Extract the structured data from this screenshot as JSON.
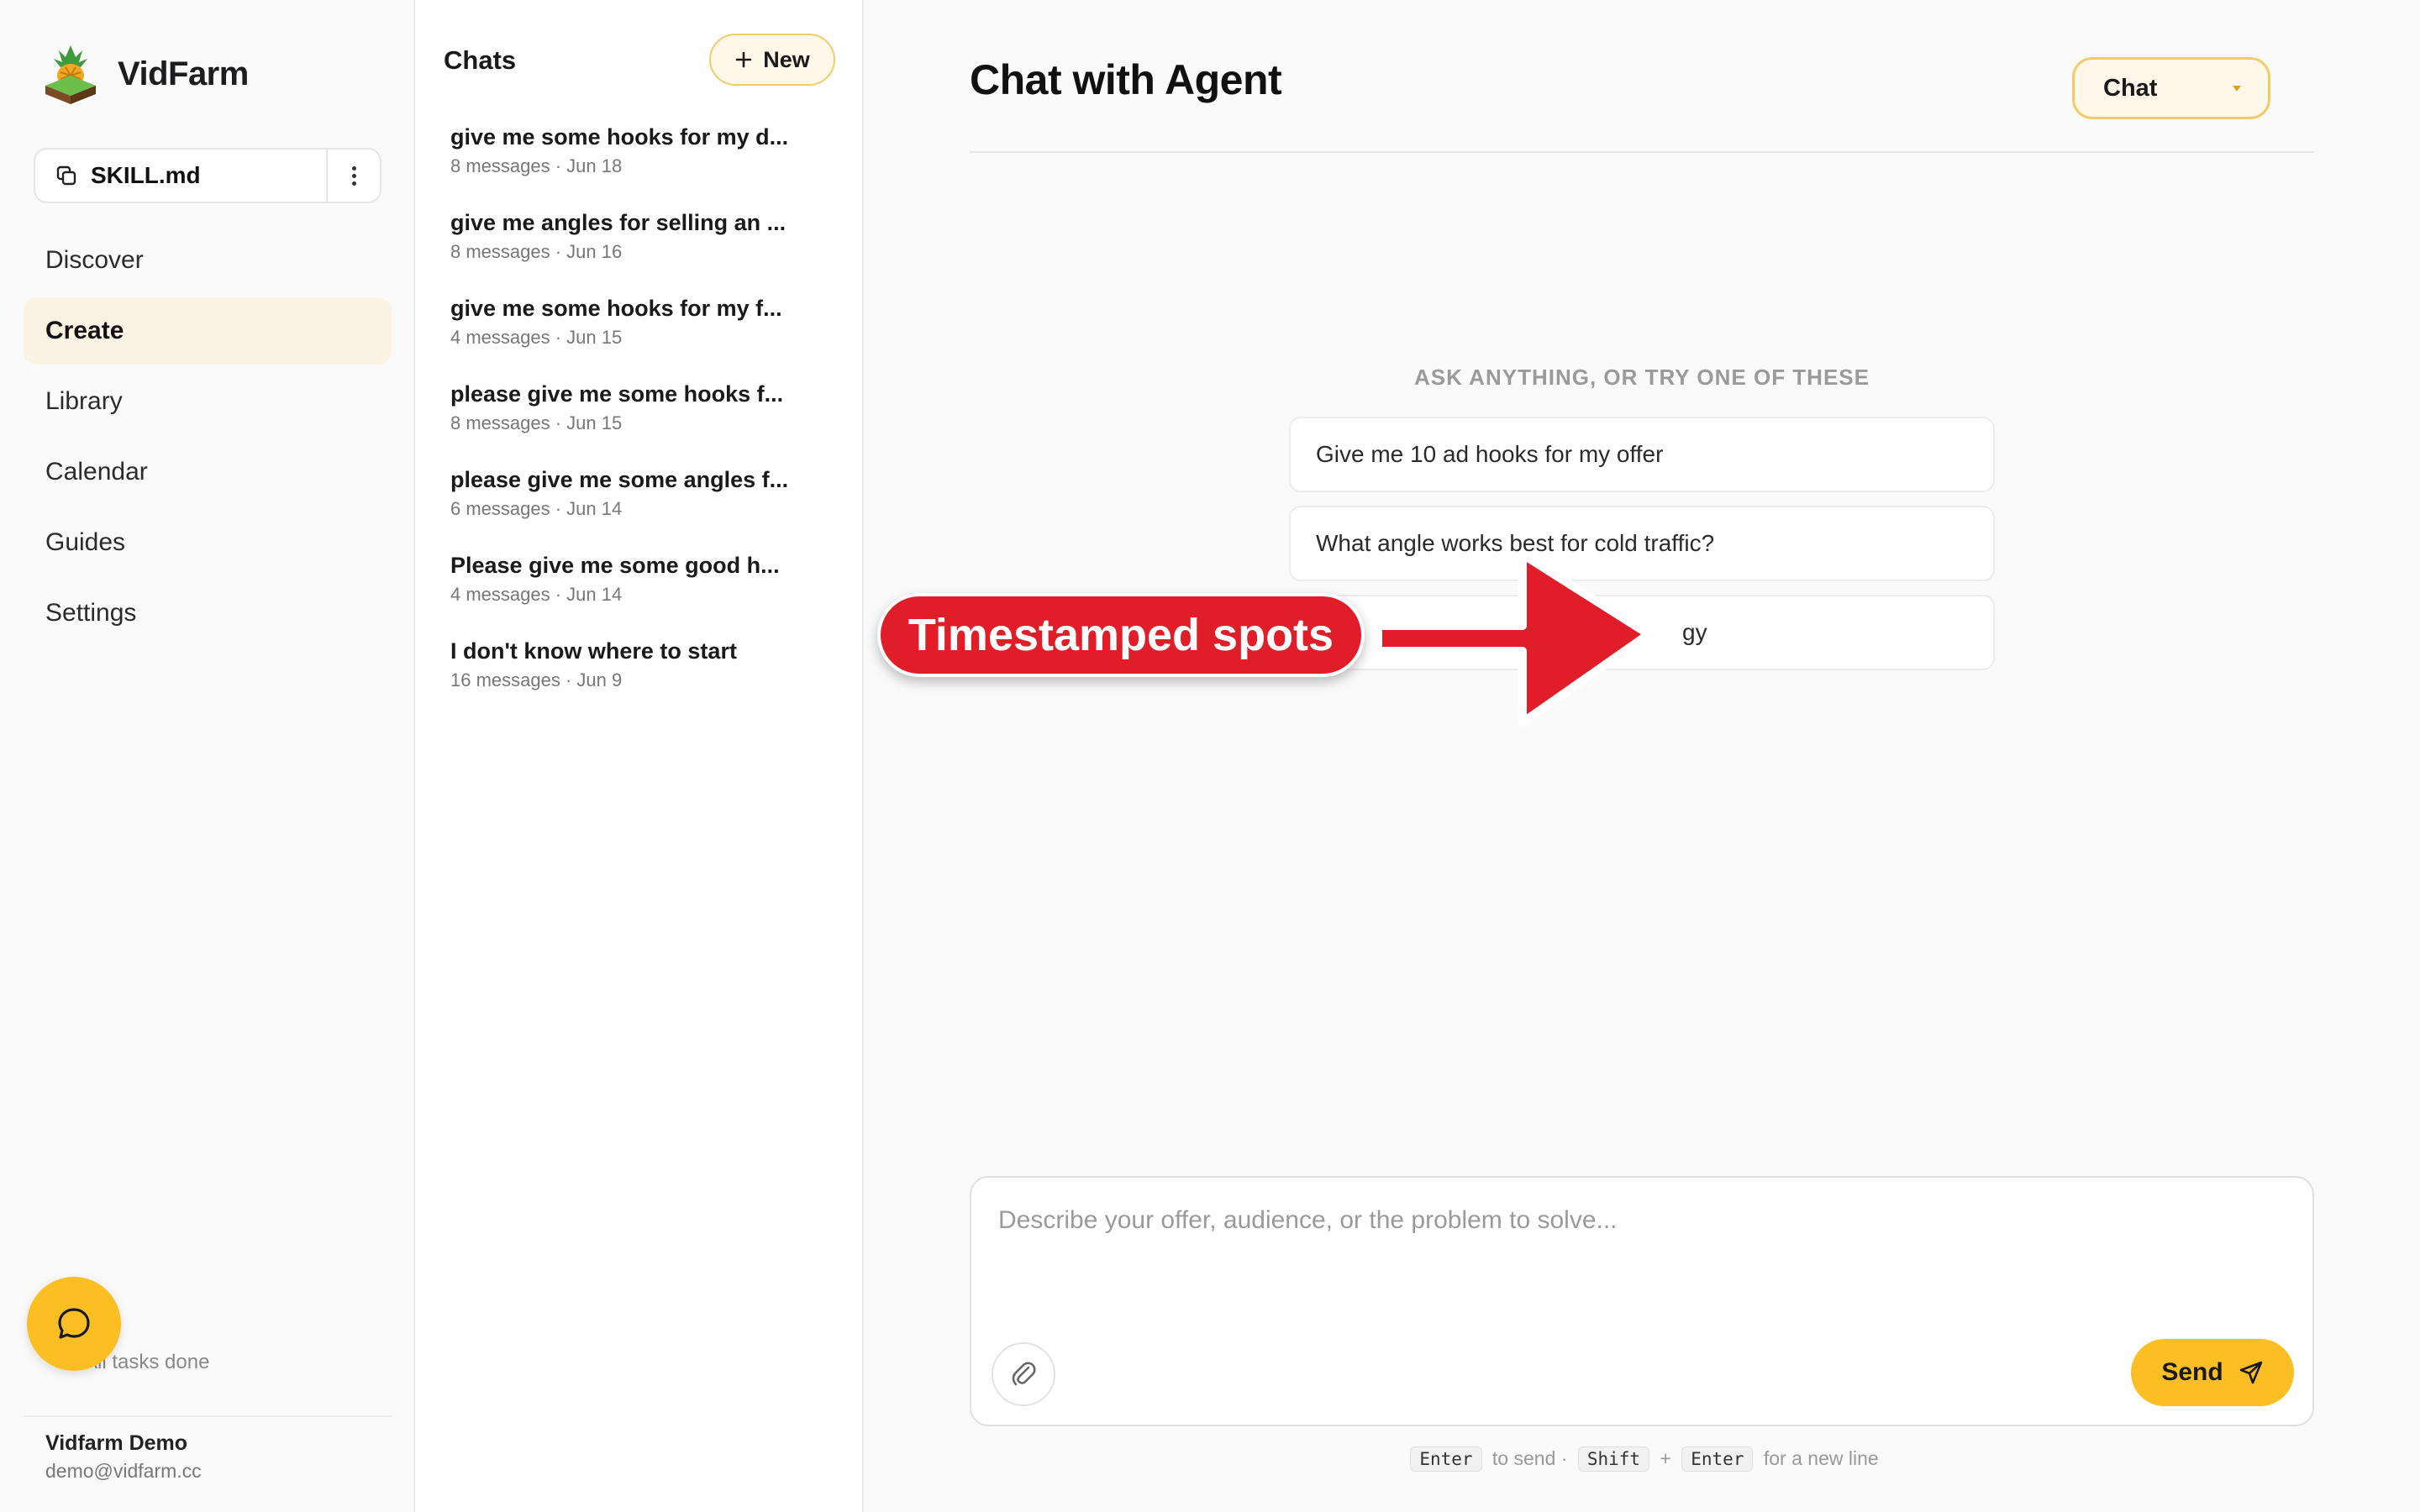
{
  "brand": {
    "name": "VidFarm"
  },
  "skill": {
    "label": "SKILL.md"
  },
  "nav": {
    "items": [
      {
        "label": "Discover",
        "active": false
      },
      {
        "label": "Create",
        "active": true
      },
      {
        "label": "Library",
        "active": false
      },
      {
        "label": "Calendar",
        "active": false
      },
      {
        "label": "Guides",
        "active": false
      },
      {
        "label": "Settings",
        "active": false
      }
    ]
  },
  "status": {
    "tasks": "All tasks done"
  },
  "user": {
    "name": "Vidfarm Demo",
    "email": "demo@vidfarm.cc"
  },
  "chats": {
    "title": "Chats",
    "new_label": "New",
    "items": [
      {
        "title": "give me some hooks for my d...",
        "meta": "8 messages · Jun 18"
      },
      {
        "title": "give me angles for selling an ...",
        "meta": "8 messages · Jun 16"
      },
      {
        "title": "give me some hooks for my f...",
        "meta": "4 messages · Jun 15"
      },
      {
        "title": "please give me some hooks f...",
        "meta": "8 messages · Jun 15"
      },
      {
        "title": "please give me some angles f...",
        "meta": "6 messages · Jun 14"
      },
      {
        "title": "Please give me some good h...",
        "meta": "4 messages · Jun 14"
      },
      {
        "title": "I don't know where to start",
        "meta": "16 messages · Jun 9"
      }
    ]
  },
  "main": {
    "title": "Chat with Agent",
    "mode": "Chat",
    "suggest_heading": "ASK ANYTHING, OR TRY ONE OF THESE",
    "suggestions": [
      "Give me 10 ad hooks for my offer",
      "What angle works best for cold traffic?",
      "gy"
    ],
    "composer_placeholder": "Describe your offer, audience, or the problem to solve...",
    "send_label": "Send",
    "hint": {
      "key_enter": "Enter",
      "to_send": "to send ·",
      "key_shift": "Shift",
      "plus": "+",
      "key_enter2": "Enter",
      "new_line": "for a new line"
    }
  },
  "annotation": {
    "label": "Timestamped spots"
  },
  "colors": {
    "accent": "#fbbf24",
    "active_nav": "#fdf3e4",
    "annotation": "#e11d2a"
  },
  "icons": [
    "pineapple-logo-icon",
    "copy-icon",
    "more-vertical-icon",
    "plus-icon",
    "chat-bubble-icon",
    "paperclip-icon",
    "send-icon",
    "chevron-down-icon"
  ]
}
